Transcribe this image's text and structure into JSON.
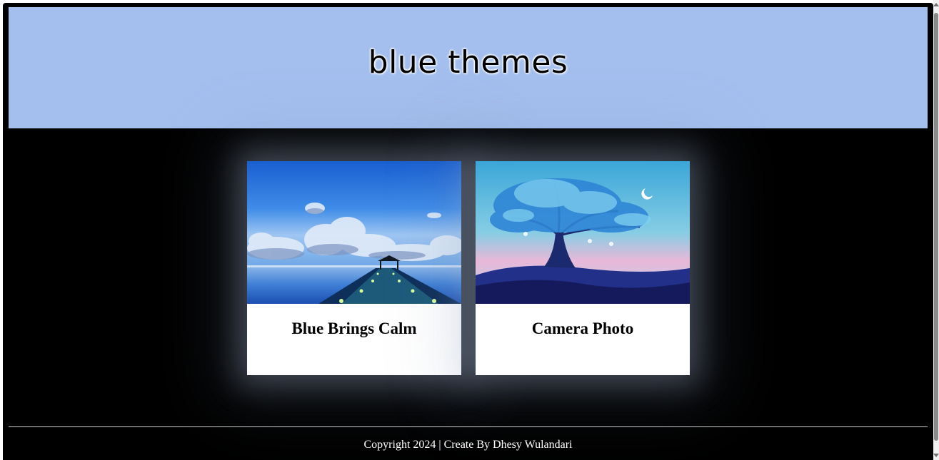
{
  "header": {
    "title": "blue themes"
  },
  "cards": [
    {
      "title": "Blue Brings Calm",
      "image": "pier-over-calm-sea-photo"
    },
    {
      "title": "Camera Photo",
      "image": "blue-tree-painting"
    }
  ],
  "footer": {
    "text": "Copyright 2024 | Create By Dhesy Wulandari"
  },
  "colors": {
    "header_bg": "#a4bfee",
    "page_bg": "#000000",
    "card_bg": "#ffffff",
    "footer_text": "#ffffff"
  }
}
